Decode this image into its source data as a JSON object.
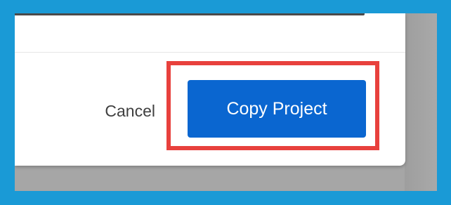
{
  "dialog": {
    "cancel_label": "Cancel",
    "copy_label": "Copy Project"
  },
  "colors": {
    "frame_border": "#1a9ad6",
    "primary_button": "#0a66d0",
    "highlight": "#e8413d",
    "backdrop": "#a6a6a6"
  }
}
